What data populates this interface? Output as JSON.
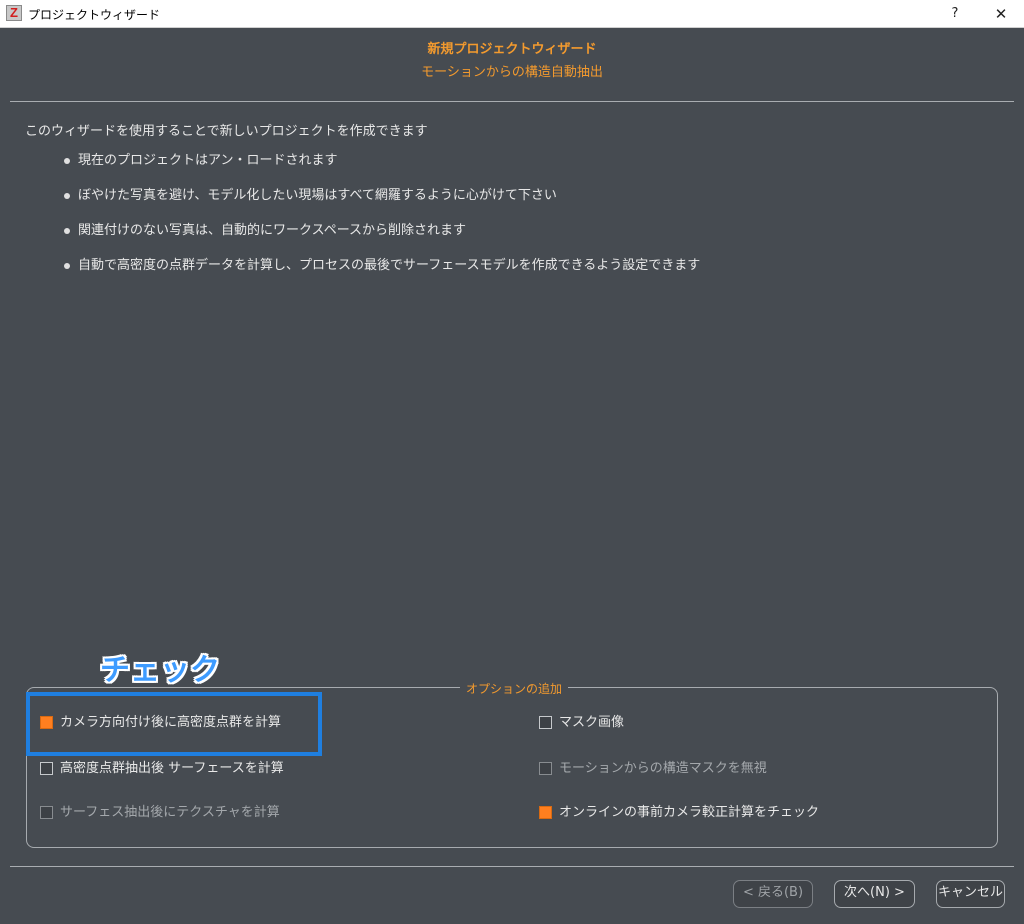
{
  "window": {
    "title": "プロジェクトウィザード",
    "app_icon": "Z",
    "help_label": "?",
    "close_label": "✕"
  },
  "header": {
    "title": "新規プロジェクトウィザード",
    "subtitle": "モーションからの構造自動抽出"
  },
  "intro": "このウィザードを使用することで新しいプロジェクトを作成できます",
  "bullets": [
    "現在のプロジェクトはアン・ロードされます",
    "ぼやけた写真を避け、モデル化したい現場はすべて網羅するように心がけて下さい",
    "関連付けのない写真は、自動的にワークスペースから削除されます",
    "自動で高密度の点群データを計算し、プロセスの最後でサーフェースモデルを作成できるよう設定できます"
  ],
  "annotation": "チェック",
  "options": {
    "legend": "オプションの追加",
    "items": [
      {
        "label": "カメラ方向付け後に高密度点群を計算",
        "checked": true,
        "enabled": true
      },
      {
        "label": "マスク画像",
        "checked": false,
        "enabled": true
      },
      {
        "label": "高密度点群抽出後 サーフェースを計算",
        "checked": false,
        "enabled": true
      },
      {
        "label": "モーションからの構造マスクを無視",
        "checked": false,
        "enabled": false
      },
      {
        "label": "サーフェス抽出後にテクスチャを計算",
        "checked": false,
        "enabled": false
      },
      {
        "label": "オンラインの事前カメラ較正計算をチェック",
        "checked": true,
        "enabled": true
      }
    ]
  },
  "buttons": {
    "back": "< 戻る(B)",
    "next": "次へ(N) >",
    "cancel": "キャンセル"
  },
  "colors": {
    "accent": "#f39a2e",
    "background": "#464b51",
    "checkbox_checked": "#ff7f1f",
    "annotation": "#3d9bff"
  }
}
